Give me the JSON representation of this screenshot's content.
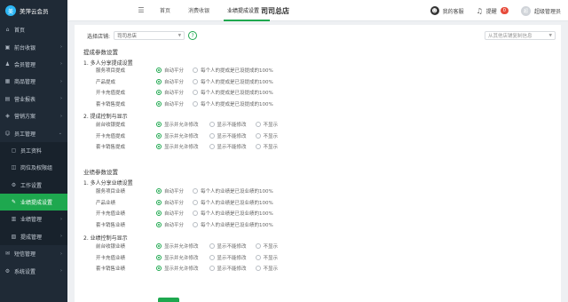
{
  "brand": {
    "name": "美萍云会员",
    "logo_char": "美"
  },
  "sidebar": {
    "items": [
      {
        "label": "首页",
        "icon": "home-icon",
        "glyph": "⌂",
        "chev": ""
      },
      {
        "label": "前台收银",
        "icon": "cashier-icon",
        "glyph": "▣",
        "chev": "›"
      },
      {
        "label": "会员管理",
        "icon": "member-icon",
        "glyph": "♟",
        "chev": "›"
      },
      {
        "label": "商品管理",
        "icon": "goods-icon",
        "glyph": "▦",
        "chev": "›"
      },
      {
        "label": "营业报表",
        "icon": "report-icon",
        "glyph": "▤",
        "chev": "›"
      },
      {
        "label": "营销方案",
        "icon": "marketing-icon",
        "glyph": "◈",
        "chev": "›"
      },
      {
        "label": "员工管理",
        "icon": "staff-icon",
        "glyph": "☺",
        "chev": "⌄"
      },
      {
        "label": "员工资料",
        "icon": "profile-icon",
        "glyph": "▢",
        "chev": "",
        "sub": true
      },
      {
        "label": "岗位及权限组",
        "icon": "role-icon",
        "glyph": "◫",
        "chev": "",
        "sub": true
      },
      {
        "label": "工作设置",
        "icon": "work-settings-icon",
        "glyph": "⚙",
        "chev": "",
        "sub": true
      },
      {
        "label": "业绩提成设置",
        "icon": "commission-icon",
        "glyph": "✎",
        "chev": "",
        "sub": true,
        "active": true
      },
      {
        "label": "业绩管理",
        "icon": "performance-icon",
        "glyph": "▥",
        "chev": "›",
        "sub": true
      },
      {
        "label": "提成管理",
        "icon": "commission-manage-icon",
        "glyph": "▧",
        "chev": "›",
        "sub": true
      },
      {
        "label": "短信管理",
        "icon": "sms-icon",
        "glyph": "✉",
        "chev": "›"
      },
      {
        "label": "系统设置",
        "icon": "system-settings-icon",
        "glyph": "⚙",
        "chev": "›"
      }
    ]
  },
  "topbar": {
    "menu_icon": "☰",
    "tabs": [
      {
        "label": "首页",
        "active": false,
        "closable": false
      },
      {
        "label": "消费收银",
        "active": false,
        "closable": false
      },
      {
        "label": "业绩提成设置",
        "active": true,
        "closable": true
      }
    ],
    "close_glyph": "×",
    "store_title": "司司总店",
    "help_label": "我的客服",
    "reminder_label": "提醒",
    "reminder_count": "0",
    "user_label": "超级管理员",
    "avatar_char": "超"
  },
  "filter": {
    "store_label": "选择店铺:",
    "store_value": "司司总店",
    "help_glyph": "?",
    "copy_placeholder": "从其他店铺复制信息"
  },
  "commission": {
    "section_title": "提成参数设置",
    "group1_title": "1. 多人分享提成设置",
    "group1_rows": [
      {
        "label": "服务项目提成"
      },
      {
        "label": "产品提成"
      },
      {
        "label": "开卡充值提成"
      },
      {
        "label": "套卡销售提成"
      }
    ],
    "group1_options": [
      "自动平分",
      "每个人的提成是已设提成的100%"
    ],
    "group2_title": "2. 提成控制与显示",
    "group2_rows": [
      {
        "label": "前台收银提成"
      },
      {
        "label": "开卡充值提成"
      },
      {
        "label": "套卡销售提成"
      }
    ],
    "group2_options": [
      "显示并允许修改",
      "显示不能修改",
      "不显示"
    ]
  },
  "performance": {
    "section_title": "业绩参数设置",
    "group1_title": "1. 多人分享业绩设置",
    "group1_rows": [
      {
        "label": "服务项目业绩"
      },
      {
        "label": "产品业绩"
      },
      {
        "label": "开卡充值业绩"
      },
      {
        "label": "套卡销售业绩"
      }
    ],
    "group1_options": [
      "自动平分",
      "每个人的业绩是已设业绩的100%"
    ],
    "group2_title": "2. 业绩控制与显示",
    "group2_rows": [
      {
        "label": "前台收银业绩"
      },
      {
        "label": "开卡充值业绩"
      },
      {
        "label": "套卡销售业绩"
      }
    ],
    "group2_options": [
      "显示并允许修改",
      "显示不能修改",
      "不显示"
    ]
  },
  "colors": {
    "accent": "#1ea84f",
    "sidebar_bg": "#1f2a36",
    "badge": "#e74c3c"
  }
}
